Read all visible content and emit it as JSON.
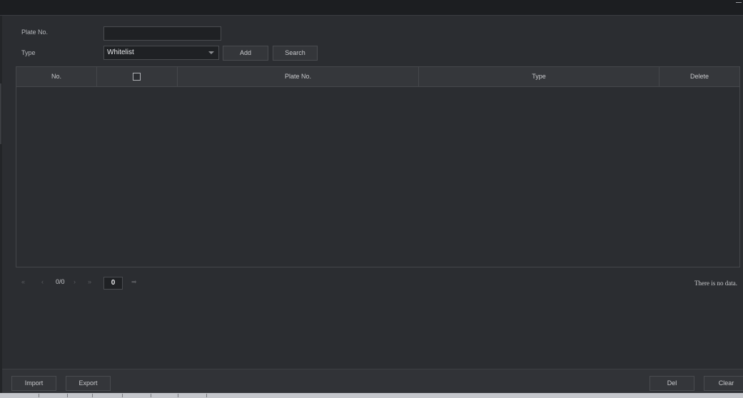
{
  "form": {
    "plate_label": "Plate No.",
    "plate_value": "",
    "type_label": "Type",
    "type_selected": "Whitelist",
    "add_label": "Add",
    "search_label": "Search"
  },
  "table": {
    "columns": [
      "No.",
      "",
      "Plate No.",
      "Type",
      "Delete"
    ],
    "rows": []
  },
  "pager": {
    "page_counter": "0/0",
    "page_input": "0",
    "no_data": "There is no data."
  },
  "footer": {
    "import_label": "Import",
    "export_label": "Export",
    "del_label": "Del",
    "clear_label": "Clear"
  }
}
